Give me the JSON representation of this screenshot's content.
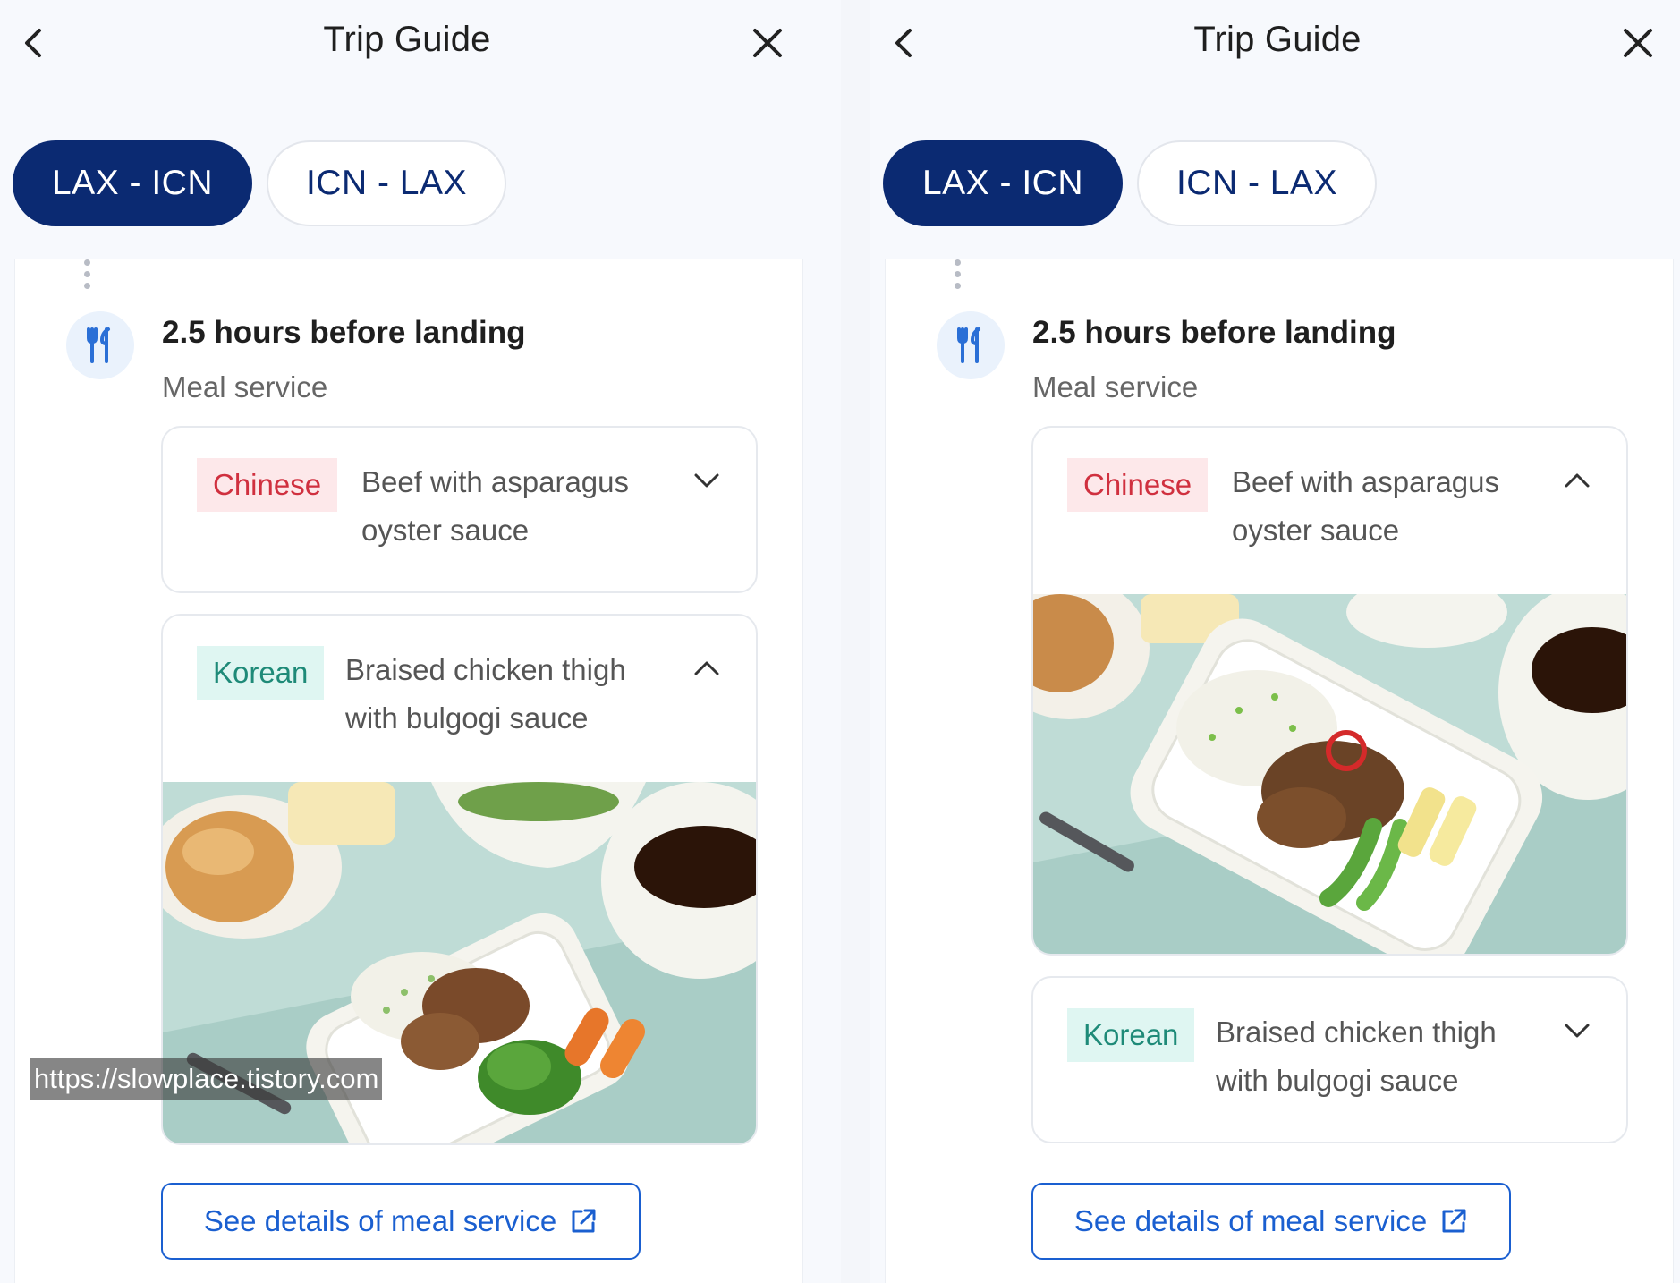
{
  "panels": [
    {
      "header": {
        "title": "Trip Guide"
      },
      "tabs": [
        {
          "label": "LAX - ICN",
          "active": true
        },
        {
          "label": "ICN - LAX",
          "active": false
        }
      ],
      "section": {
        "title": "2.5 hours before landing",
        "subtitle": "Meal service",
        "icon": "utensils-icon"
      },
      "meals": [
        {
          "tag": "Chinese",
          "name_line1": "Beef with asparagus",
          "name_line2": "oyster sauce",
          "expanded": false
        },
        {
          "tag": "Korean",
          "name_line1": "Braised chicken thigh",
          "name_line2": "with bulgogi sauce",
          "expanded": true
        }
      ],
      "details_button": "See details of meal service"
    },
    {
      "header": {
        "title": "Trip Guide"
      },
      "tabs": [
        {
          "label": "LAX - ICN",
          "active": true
        },
        {
          "label": "ICN - LAX",
          "active": false
        }
      ],
      "section": {
        "title": "2.5 hours before landing",
        "subtitle": "Meal service",
        "icon": "utensils-icon"
      },
      "meals": [
        {
          "tag": "Chinese",
          "name_line1": "Beef with asparagus",
          "name_line2": "oyster sauce",
          "expanded": true
        },
        {
          "tag": "Korean",
          "name_line1": "Braised chicken thigh",
          "name_line2": "with bulgogi sauce",
          "expanded": false
        }
      ],
      "details_button": "See details of meal service"
    }
  ],
  "watermark": "https://slowplace.tistory.com",
  "colors": {
    "navy": "#0b2a72",
    "link_blue": "#1a5fd0",
    "chinese_tag": "#d0303f",
    "korean_tag": "#1e8a78"
  }
}
